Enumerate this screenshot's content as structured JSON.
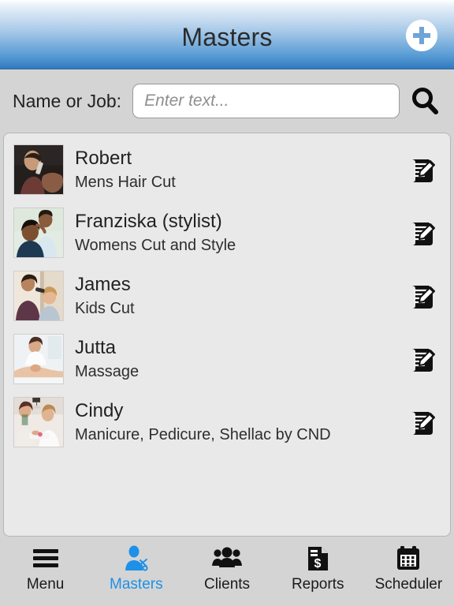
{
  "header": {
    "title": "Masters",
    "add_button_name": "add-master-button",
    "gradient_top": "#ffffff",
    "gradient_bottom": "#3179bf"
  },
  "search": {
    "label": "Name or Job:",
    "value": "",
    "placeholder": "Enter text...",
    "search_icon": "search-icon"
  },
  "list": {
    "items": [
      {
        "name": "Robert",
        "job": "Mens Hair Cut",
        "edit_icon": "edit-note-icon",
        "photo": "barber-cutting-mans-hair"
      },
      {
        "name": "Franziska (stylist)",
        "job": "Womens Cut and Style",
        "edit_icon": "edit-note-icon",
        "photo": "stylist-styling-womans-hair"
      },
      {
        "name": "James",
        "job": "Kids Cut",
        "edit_icon": "edit-note-icon",
        "photo": "barber-cutting-childs-hair"
      },
      {
        "name": "Jutta",
        "job": "Massage",
        "edit_icon": "edit-note-icon",
        "photo": "therapist-giving-massage"
      },
      {
        "name": "Cindy",
        "job": "Manicure, Pedicure, Shellac by CND",
        "edit_icon": "edit-note-icon",
        "photo": "manicurist-with-client"
      }
    ]
  },
  "tabbar": {
    "active_color": "#1e90e8",
    "items": [
      {
        "label": "Menu",
        "icon": "hamburger-menu-icon",
        "active": false
      },
      {
        "label": "Masters",
        "icon": "person-scissors-icon",
        "active": true
      },
      {
        "label": "Clients",
        "icon": "people-group-icon",
        "active": false
      },
      {
        "label": "Reports",
        "icon": "document-dollar-icon",
        "active": false
      },
      {
        "label": "Scheduler",
        "icon": "calendar-icon",
        "active": false
      }
    ]
  }
}
